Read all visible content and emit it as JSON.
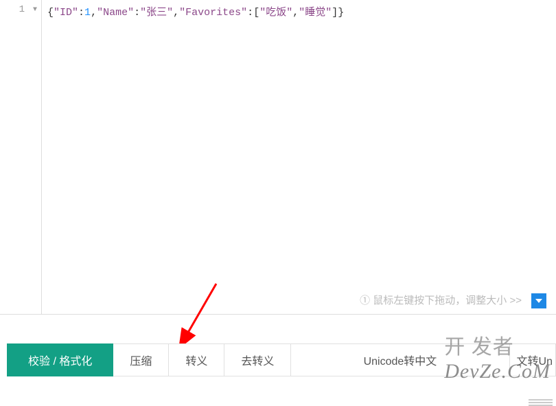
{
  "editor": {
    "line_number": "1",
    "json_raw": {
      "key_id": "\"ID\"",
      "val_id": "1",
      "key_name": "\"Name\"",
      "val_name": "\"张三\"",
      "key_fav": "\"Favorites\"",
      "fav_0": "\"吃饭\"",
      "fav_1": "\"睡觉\""
    },
    "resize_hint": "① 鼠标左键按下拖动，调整大小 >>"
  },
  "toolbar": {
    "buttons": [
      {
        "label": "校验 / 格式化",
        "active": true
      },
      {
        "label": "压缩",
        "active": false
      },
      {
        "label": "转义",
        "active": false
      },
      {
        "label": "去转义",
        "active": false
      },
      {
        "label": "Unicode转中文",
        "active": false
      }
    ],
    "overflow_text": "文转Un"
  },
  "watermark": {
    "text_prefix": "开 发者",
    "text_brand": "DevZe.CoM"
  }
}
